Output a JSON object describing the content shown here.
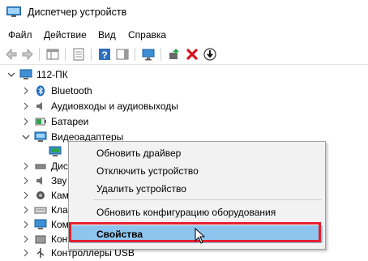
{
  "window": {
    "title": "Диспетчер устройств"
  },
  "menubar": [
    "Файл",
    "Действие",
    "Вид",
    "Справка"
  ],
  "toolbar": {
    "icons": [
      "back-arrow-icon",
      "forward-arrow-icon",
      "show-hide-tree-icon",
      "properties-icon",
      "help-icon",
      "action-pane-icon",
      "scan-hardware-icon",
      "update-driver-icon",
      "uninstall-icon",
      "download-driver-icon"
    ]
  },
  "tree": {
    "root": "112-ПК",
    "items": [
      {
        "label": "Bluetooth",
        "icon": "bluetooth-icon"
      },
      {
        "label": "Аудиовходы и аудиовыходы",
        "icon": "speaker-icon"
      },
      {
        "label": "Батареи",
        "icon": "battery-icon"
      },
      {
        "label": "Видеоадаптеры",
        "icon": "display-adapter-icon",
        "expanded": true
      },
      {
        "label": "",
        "icon": "display-adapter-device-icon"
      },
      {
        "label": "Дисп",
        "icon": "disk-drive-icon"
      },
      {
        "label": "Зву",
        "icon": "sound-icon"
      },
      {
        "label": "Кам",
        "icon": "camera-icon"
      },
      {
        "label": "Кла",
        "icon": "keyboard-icon"
      },
      {
        "label": "Ком",
        "icon": "computer-icon"
      },
      {
        "label": "Конт",
        "icon": "controller-icon"
      },
      {
        "label": "Контроллеры USB",
        "icon": "usb-icon"
      }
    ]
  },
  "context_menu": {
    "items": [
      "Обновить драйвер",
      "Отключить устройство",
      "Удалить устройство",
      "Обновить конфигурацию оборудования",
      "Свойства"
    ]
  },
  "colors": {
    "menu_highlight": "#8ec5ee",
    "red_outline": "#e2202e",
    "red_x": "#d4141e",
    "blue_help": "#2f6fbf"
  }
}
